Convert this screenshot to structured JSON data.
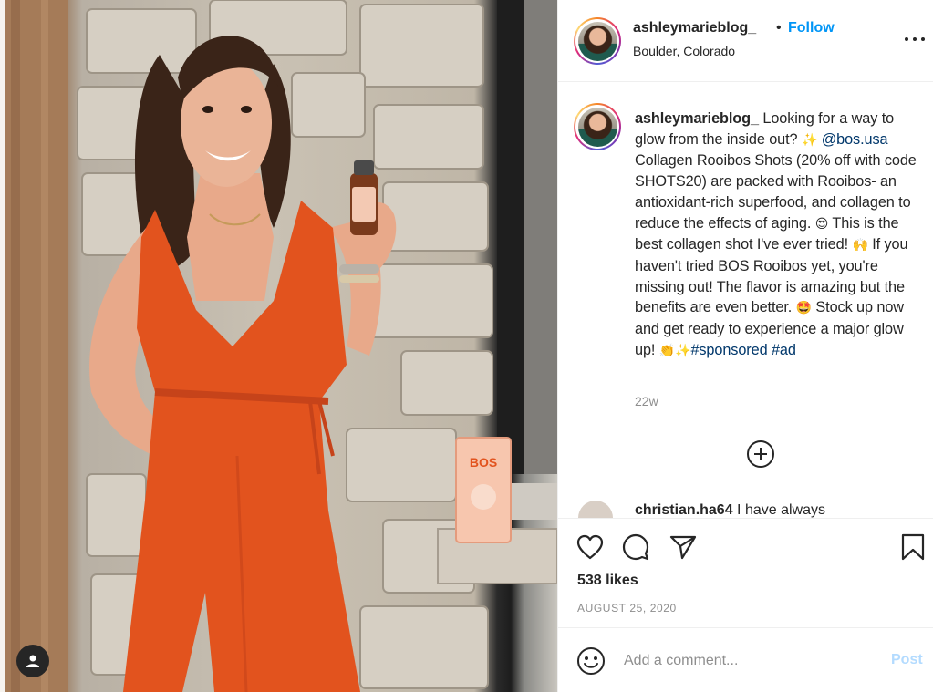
{
  "post": {
    "username": "ashleymarieblog_",
    "follow_label": "Follow",
    "separator": "•",
    "location": "Boulder, Colorado",
    "photo_product_label": "BOS"
  },
  "caption": {
    "username": "ashleymarieblog_",
    "part1": " Looking for a way to glow from the inside out? ",
    "emoji1": "✨",
    "mention": "@bos.usa",
    "part2": " Collagen Rooibos Shots (20% off with code SHOTS20) are packed with Rooibos- an antioxidant-rich superfood, and collagen to reduce the effects of aging. ",
    "emoji2": "😍",
    "part3": " This is the best collagen shot I've ever tried! ",
    "emoji3": "🙌",
    "part4": " If you haven't tried BOS Rooibos yet, you're missing out! The flavor is amazing but the benefits are even better. ",
    "emoji4": "🤩",
    "part5": " Stock up now and get ready to experience a major glow up! ",
    "emoji5": "👏✨",
    "hashtag1": "#sponsored",
    "hashtag2": "#ad",
    "time_ago": "22w"
  },
  "next_comment": {
    "username": "christian.ha64",
    "text": " I have always"
  },
  "stats": {
    "likes": "538 likes",
    "date": "AUGUST 25, 2020"
  },
  "comment_box": {
    "placeholder": "Add a comment...",
    "post_label": "Post"
  },
  "icons": {
    "like": "heart-icon",
    "comment": "comment-icon",
    "share": "paper-plane-icon",
    "save": "bookmark-icon",
    "more": "more-options-icon",
    "load_more": "plus-circle-icon",
    "emoji": "smiley-icon",
    "tag": "user-tag-icon"
  },
  "colors": {
    "accent": "#0095f6",
    "link": "#00376b",
    "muted": "#8e8e8e",
    "post_disabled": "#b3dbff",
    "dress": "#e2531e"
  }
}
